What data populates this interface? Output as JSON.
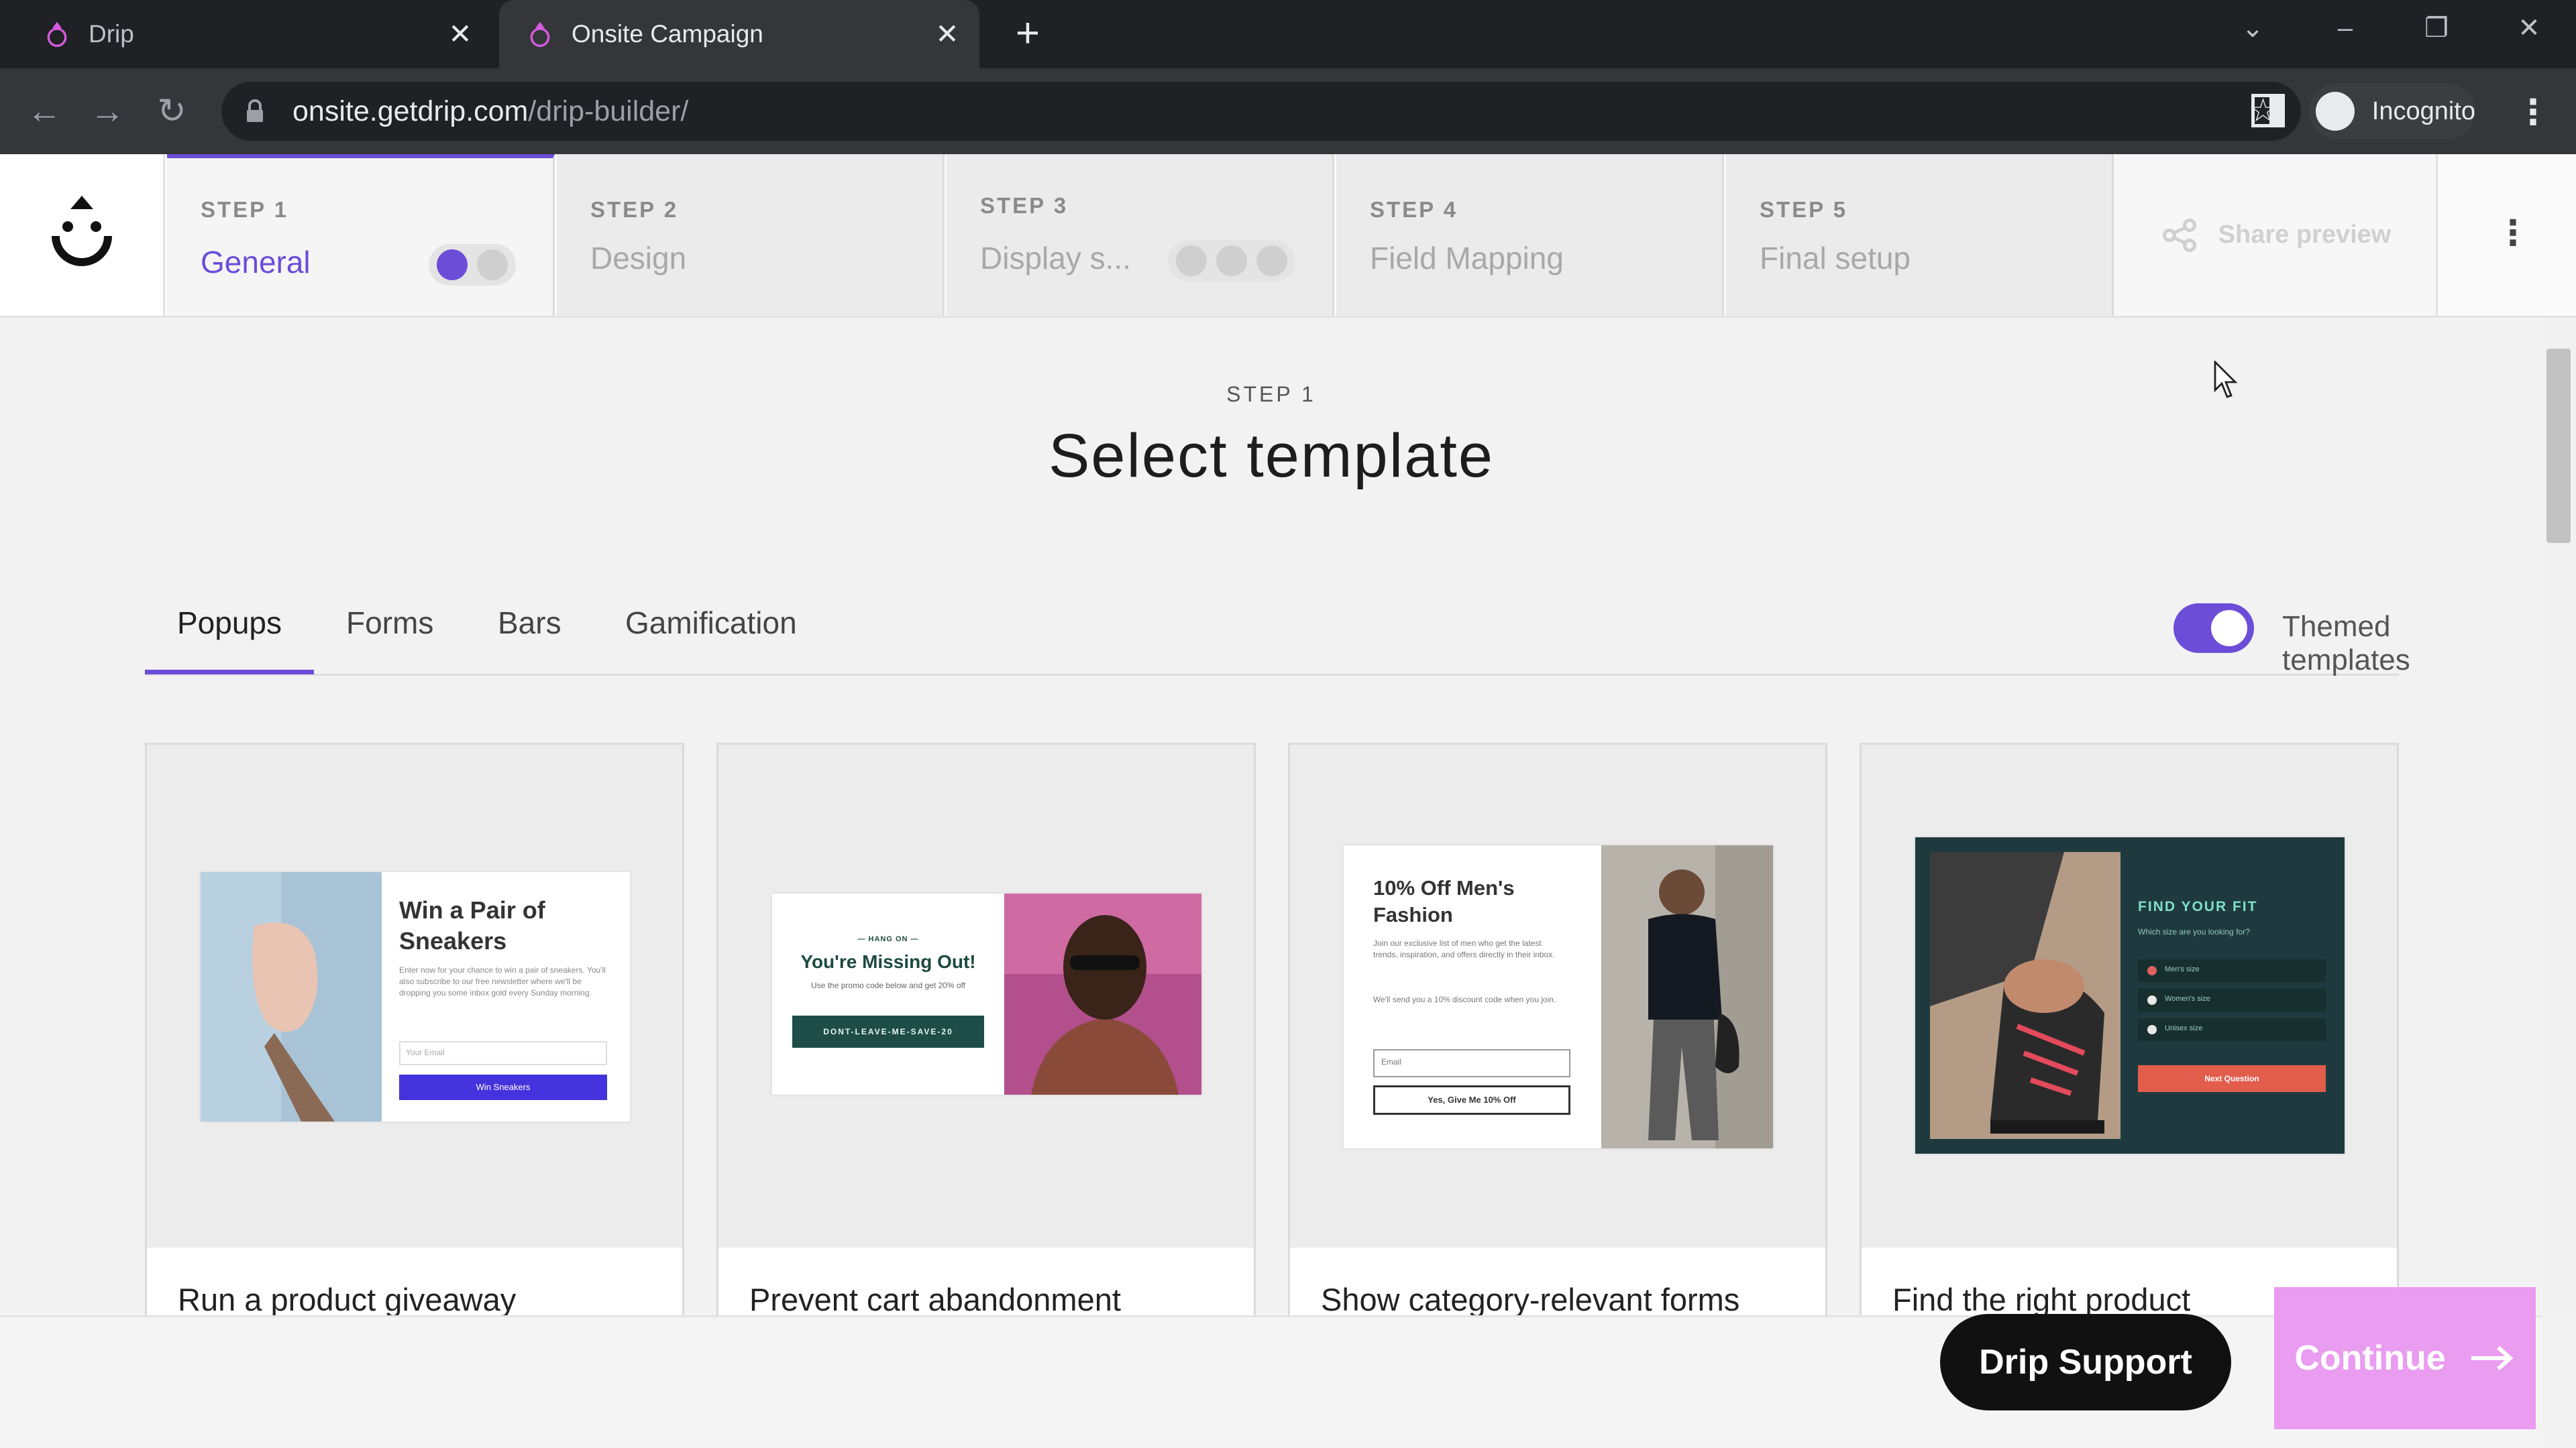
{
  "browser": {
    "tabs": [
      {
        "title": "Drip"
      },
      {
        "title": "Onsite Campaign"
      }
    ],
    "url_host": "onsite.getdrip.com",
    "url_path": "/drip-builder/",
    "profile_label": "Incognito"
  },
  "stepper": {
    "steps": [
      {
        "num": "STEP 1",
        "label": "General"
      },
      {
        "num": "STEP 2",
        "label": "Design"
      },
      {
        "num": "STEP 3",
        "label": "Display s..."
      },
      {
        "num": "STEP 4",
        "label": "Field Mapping"
      },
      {
        "num": "STEP 5",
        "label": "Final setup"
      }
    ],
    "share_label": "Share preview"
  },
  "main": {
    "step_label": "STEP 1",
    "title": "Select template",
    "tabs": [
      "Popups",
      "Forms",
      "Bars",
      "Gamification"
    ],
    "themed_label": "Themed templates",
    "themed_on": true,
    "cards": [
      {
        "caption": "Run a product giveaway",
        "popup_title": "Win a Pair of Sneakers",
        "popup_body": "Enter now for your chance to win a pair of sneakers. You'll also subscribe to our free newsletter where we'll be dropping you some inbox gold every Sunday morning.",
        "popup_input": "Your Email",
        "popup_button": "Win Sneakers"
      },
      {
        "caption": "Prevent cart abandonment",
        "popup_kicker": "— HANG ON —",
        "popup_title": "You're Missing Out!",
        "popup_body": "Use the promo code below and get 20% off",
        "popup_code": "DONT-LEAVE-ME-SAVE-20"
      },
      {
        "caption": "Show category-relevant forms",
        "popup_title": "10% Off Men's Fashion",
        "popup_body": "Join our exclusive list of men who get the latest trends, inspiration, and offers directly in their inbox.",
        "popup_body2": "We'll send you a 10% discount code when you join.",
        "popup_input": "Email",
        "popup_button": "Yes, Give Me 10% Off"
      },
      {
        "caption": "Find the right product",
        "popup_title": "FIND YOUR FIT",
        "popup_body": "Which size are you looking for?",
        "options": [
          "Men's size",
          "Women's size",
          "Unisex size"
        ],
        "popup_button": "Next Question"
      }
    ]
  },
  "footer": {
    "support_label": "Drip Support",
    "continue_label": "Continue"
  },
  "colors": {
    "accent": "#6b4dd8",
    "continue_bg": "#e99cf0",
    "support_bg": "#111111"
  }
}
